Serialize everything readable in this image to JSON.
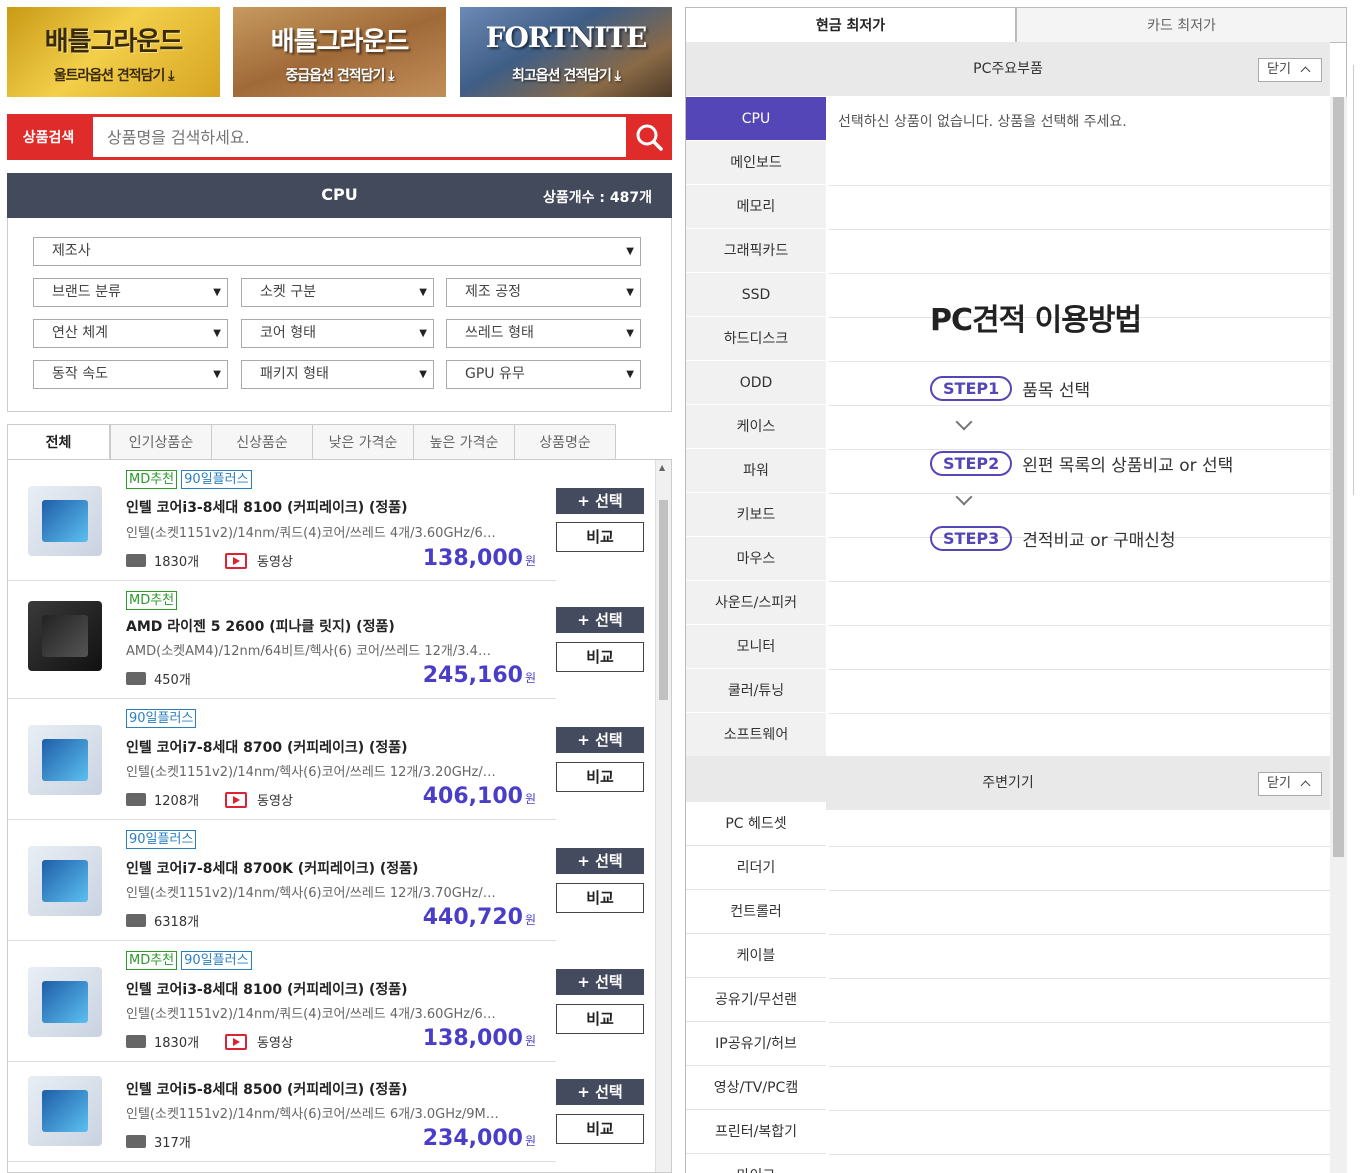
{
  "banners": [
    {
      "title": "배틀그라운드",
      "sub": "울트라옵션 견적담기 ⤓"
    },
    {
      "title": "배틀그라운드",
      "sub": "중급옵션 견적담기 ⤓"
    },
    {
      "title": "FORTNITE",
      "sub": "최고옵션 견적담기 ⤓"
    }
  ],
  "search": {
    "label": "상품검색",
    "placeholder": "상품명을 검색하세요."
  },
  "category": {
    "title": "CPU",
    "count": "상품개수 : 487개"
  },
  "filters": {
    "maker": "제조사",
    "row2": [
      "브랜드 분류",
      "소켓 구분",
      "제조 공정"
    ],
    "row3": [
      "연산 체계",
      "코어 형태",
      "쓰레드 형태"
    ],
    "row4": [
      "동작 속도",
      "패키지 형태",
      "GPU 유무"
    ]
  },
  "sort_tabs": [
    "전체",
    "인기상품순",
    "신상품순",
    "낮은 가격순",
    "높은 가격순",
    "상품명순"
  ],
  "buttons": {
    "select": "+ 선택",
    "compare": "비교"
  },
  "tag_labels": {
    "md": "MD추천",
    "d90": "90일플러스"
  },
  "products": [
    {
      "name": "인텔 코어i3-8세대 8100 (커피레이크) (정품)",
      "spec": "인텔(소켓1151v2)/14nm/쿼드(4)코어/쓰레드 4개/3.60GHz/6…",
      "reviews": "1830개",
      "video": "동영상",
      "price": "138,000",
      "unit": "원"
    },
    {
      "name": "AMD 라이젠 5 2600 (피나클 릿지) (정품)",
      "spec": "AMD(소켓AM4)/12nm/64비트/헥사(6) 코어/쓰레드 12개/3.4…",
      "reviews": "450개",
      "video": "",
      "price": "245,160",
      "unit": "원"
    },
    {
      "name": "인텔 코어i7-8세대 8700 (커피레이크) (정품)",
      "spec": "인텔(소켓1151v2)/14nm/헥사(6)코어/쓰레드 12개/3.20GHz/…",
      "reviews": "1208개",
      "video": "동영상",
      "price": "406,100",
      "unit": "원"
    },
    {
      "name": "인텔 코어i7-8세대 8700K (커피레이크) (정품)",
      "spec": "인텔(소켓1151v2)/14nm/헥사(6)코어/쓰레드 12개/3.70GHz/…",
      "reviews": "6318개",
      "video": "",
      "price": "440,720",
      "unit": "원"
    },
    {
      "name": "인텔 코어i3-8세대 8100 (커피레이크) (정품)",
      "spec": "인텔(소켓1151v2)/14nm/쿼드(4)코어/쓰레드 4개/3.60GHz/6…",
      "reviews": "1830개",
      "video": "동영상",
      "price": "138,000",
      "unit": "원"
    },
    {
      "name": "인텔 코어i5-8세대 8500 (커피레이크) (정품)",
      "spec": "인텔(소켓1151v2)/14nm/헥사(6)코어/쓰레드 6개/3.0GHz/9M…",
      "reviews": "317개",
      "video": "",
      "price": "234,000",
      "unit": "원"
    }
  ],
  "right": {
    "tabs": [
      "현금 최저가",
      "카드 최저가"
    ],
    "section1": "PC주요부품",
    "section2": "주변기기",
    "close": "닫기",
    "empty_msg": "선택하신 상품이 없습니다. 상품을 선택해 주세요.",
    "main_menu": [
      "CPU",
      "메인보드",
      "메모리",
      "그래픽카드",
      "SSD",
      "하드디스크",
      "ODD",
      "케이스",
      "파워",
      "키보드",
      "마우스",
      "사운드/스피커",
      "모니터",
      "쿨러/튜닝",
      "소프트웨어"
    ],
    "peri_menu": [
      "PC 헤드셋",
      "리더기",
      "컨트롤러",
      "케이블",
      "공유기/무선랜",
      "IP공유기/허브",
      "영상/TV/PC캠",
      "프린터/복합기",
      "마이크"
    ],
    "guide": {
      "title": "PC견적 이용방법",
      "steps": [
        {
          "pill": "STEP1",
          "text": "품목 선택"
        },
        {
          "pill": "STEP2",
          "text": "왼편 목록의 상품비교 or 선택"
        },
        {
          "pill": "STEP3",
          "text": "견적비교 or 구매신청"
        }
      ]
    }
  }
}
